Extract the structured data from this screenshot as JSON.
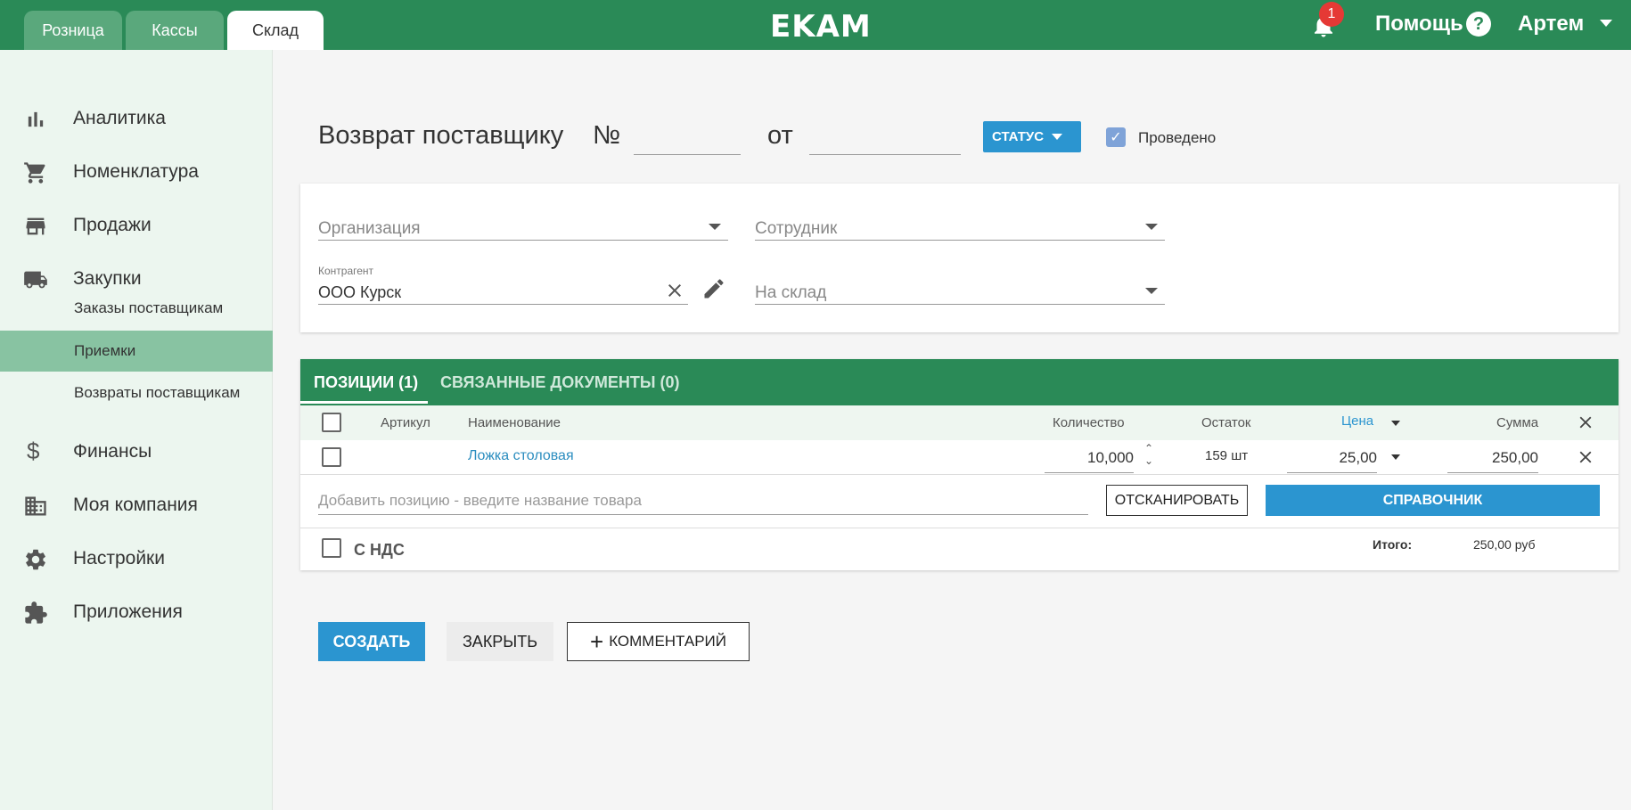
{
  "header": {
    "tabs": [
      "Розница",
      "Кассы",
      "Склад"
    ],
    "logo": "EKAM",
    "notifications_count": "1",
    "help_label": "Помощь",
    "user_name": "Артем"
  },
  "sidebar": {
    "items": [
      {
        "label": "Аналитика",
        "icon": "bar-chart-icon"
      },
      {
        "label": "Номенклатура",
        "icon": "cart-icon"
      },
      {
        "label": "Продажи",
        "icon": "store-icon"
      },
      {
        "label": "Закупки",
        "icon": "truck-icon"
      },
      {
        "label": "Финансы",
        "icon": "dollar-icon"
      },
      {
        "label": "Моя компания",
        "icon": "building-icon"
      },
      {
        "label": "Настройки",
        "icon": "gear-icon"
      },
      {
        "label": "Приложения",
        "icon": "puzzle-icon"
      }
    ],
    "subitems": [
      "Заказы поставщикам",
      "Приемки",
      "Возвраты поставщикам"
    ]
  },
  "doc": {
    "title": "Возврат поставщику",
    "number_label": "№",
    "from_label": "от",
    "status_button": "СТАТУС",
    "posted_label": "Проведено"
  },
  "form": {
    "organization_placeholder": "Организация",
    "employee_placeholder": "Сотрудник",
    "counterparty_label": "Контрагент",
    "counterparty_value": "ООО Курск",
    "warehouse_placeholder": "На склад"
  },
  "positions": {
    "tab_positions": "ПОЗИЦИИ (1)",
    "tab_linked": "СВЯЗАННЫЕ ДОКУМЕНТЫ (0)",
    "columns": {
      "article": "Артикул",
      "name": "Наименование",
      "quantity": "Количество",
      "stock": "Остаток",
      "price": "Цена",
      "sum": "Сумма"
    },
    "rows": [
      {
        "article": "",
        "name": "Ложка столовая",
        "quantity": "10,000",
        "stock": "159 шт",
        "price": "25,00",
        "sum": "250,00"
      }
    ],
    "add_placeholder": "Добавить позицию - введите название товара",
    "scan_button": "ОТСКАНИРОВАТЬ",
    "catalog_button": "СПРАВОЧНИК",
    "vat_label": "С НДС",
    "total_label": "Итого:",
    "total_value": "250,00 руб"
  },
  "actions": {
    "create": "СОЗДАТЬ",
    "close": "ЗАКРЫТЬ",
    "comment": "КОММЕНТАРИЙ"
  },
  "colors": {
    "brand_green": "#2a8a57",
    "accent_blue": "#2b95d0",
    "sidebar_bg": "#ecf6ef",
    "sidebar_active": "#88c3a2"
  }
}
